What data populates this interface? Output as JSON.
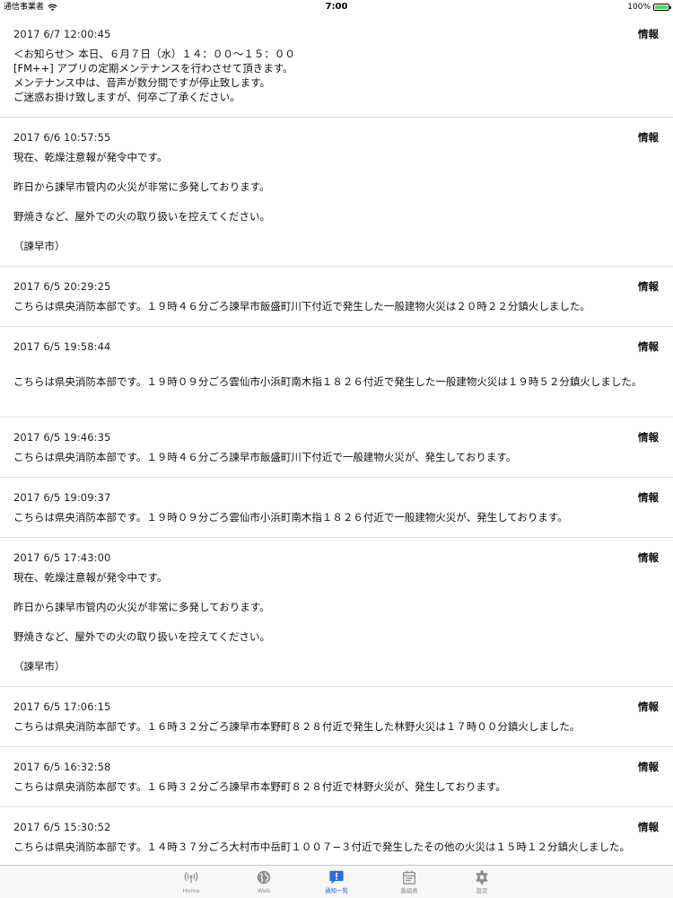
{
  "status_bar": {
    "carrier": "通信事業者",
    "time": "7:00",
    "battery": "100%"
  },
  "notifications": [
    {
      "timestamp": "2017 6/7 12:00:45",
      "category": "情報",
      "lines": [
        "＜お知らせ＞ 本日、６月７日（水）１４：００〜１５：００",
        "[FM++] アプリの定期メンテナンスを行わさせて頂きます。",
        "メンテナンス中は、音声が数分間ですが停止致します。",
        "ご迷惑お掛け致しますが、何卒ご了承ください。"
      ]
    },
    {
      "timestamp": "2017 6/6 10:57:55",
      "category": "情報",
      "lines": [
        "現在、乾燥注意報が発令中です。",
        "",
        "昨日から諫早市管内の火災が非常に多発しております。",
        "",
        "野焼きなど、屋外での火の取り扱いを控えてください。",
        "",
        "（諫早市）"
      ]
    },
    {
      "timestamp": "2017 6/5 20:29:25",
      "category": "情報",
      "lines": [
        "こちらは県央消防本部です。１９時４６分ごろ諫早市飯盛町川下付近で発生した一般建物火災は２０時２２分鎮火しました。"
      ]
    },
    {
      "timestamp": "2017 6/5 19:58:44",
      "category": "情報",
      "lines": [
        "",
        "こちらは県央消防本部です。１９時０９分ごろ雲仙市小浜町南木指１８２６付近で発生した一般建物火災は１９時５２分鎮火しました。",
        ""
      ]
    },
    {
      "timestamp": "2017 6/5 19:46:35",
      "category": "情報",
      "lines": [
        "こちらは県央消防本部です。１９時４６分ごろ諫早市飯盛町川下付近で一般建物火災が、発生しております。"
      ]
    },
    {
      "timestamp": "2017 6/5 19:09:37",
      "category": "情報",
      "lines": [
        "こちらは県央消防本部です。１９時０９分ごろ雲仙市小浜町南木指１８２６付近で一般建物火災が、発生しております。"
      ]
    },
    {
      "timestamp": "2017 6/5 17:43:00",
      "category": "情報",
      "lines": [
        "現在、乾燥注意報が発令中です。",
        "",
        "昨日から諫早市管内の火災が非常に多発しております。",
        "",
        "野焼きなど、屋外での火の取り扱いを控えてください。",
        "",
        "（諫早市）"
      ]
    },
    {
      "timestamp": "2017 6/5 17:06:15",
      "category": "情報",
      "lines": [
        "こちらは県央消防本部です。１６時３２分ごろ諫早市本野町８２８付近で発生した林野火災は１７時００分鎮火しました。"
      ]
    },
    {
      "timestamp": "2017 6/5 16:32:58",
      "category": "情報",
      "lines": [
        "こちらは県央消防本部です。１６時３２分ごろ諫早市本野町８２８付近で林野火災が、発生しております。"
      ]
    },
    {
      "timestamp": "2017 6/5 15:30:52",
      "category": "情報",
      "lines": [
        "こちらは県央消防本部です。１４時３７分ごろ大村市中岳町１００７−３付近で発生したその他の火災は１５時１２分鎮火しました。"
      ]
    }
  ],
  "tab_bar": {
    "active_color": "#2a6fdc",
    "inactive_color": "#8e8e93",
    "tabs": [
      {
        "label": "Home",
        "icon": "radio-waves-icon",
        "active": false
      },
      {
        "label": "Web",
        "icon": "globe-icon",
        "active": false
      },
      {
        "label": "通知一覧",
        "icon": "notification-icon",
        "active": true
      },
      {
        "label": "番組表",
        "icon": "calendar-icon",
        "active": false
      },
      {
        "label": "設定",
        "icon": "gear-icon",
        "active": false
      }
    ]
  }
}
